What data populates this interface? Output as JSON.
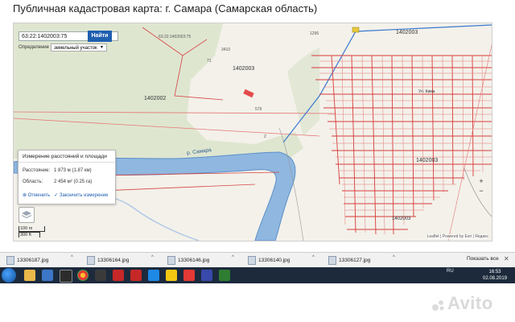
{
  "page": {
    "title": "Публичная кадастровая карта: г. Самара (Самарская область)"
  },
  "search": {
    "value": "63:22:1402003:75",
    "button": "Найти"
  },
  "definition": {
    "label": "Определение",
    "selected": "земельный участок"
  },
  "map_labels": {
    "q1": "1402002",
    "q2": "1402003",
    "q3": "1402003",
    "q4": "1402003",
    "q5": "1402003",
    "river": "р. Самара",
    "n1": "3410",
    "n2": "63:22:1402003:75",
    "n3": "1296",
    "n4": "579",
    "n5": "2",
    "n6": "71",
    "n7": "Ул. Кима"
  },
  "measure": {
    "title": "Измерение расстояний и площади",
    "distance_label": "Расстояние:",
    "distance_value": "1 873 м (1.87 км)",
    "area_label": "Область:",
    "area_value": "2 454 м² (0.25 га)",
    "cancel": "Отменить",
    "finish": "Закончить измерение"
  },
  "scale": {
    "metric": "100 m",
    "imperial": "300 ft"
  },
  "zoom": {
    "in": "+",
    "out": "−"
  },
  "attribution": "Leaflet | Powered by Esri | Яндекс",
  "downloads": {
    "items": [
      "13306187.jpg",
      "13306164.jpg",
      "13306146.jpg",
      "13306140.jpg",
      "13306127.jpg"
    ],
    "show_all": "Показать все"
  },
  "taskbar": {
    "lang": "RU",
    "time": "16:53",
    "date": "02.08.2019"
  },
  "watermark": {
    "text": "Avito"
  },
  "icons": {
    "start": "windows-start-icon",
    "layers": "layers-icon",
    "file": "file-icon",
    "close": "close-icon"
  }
}
